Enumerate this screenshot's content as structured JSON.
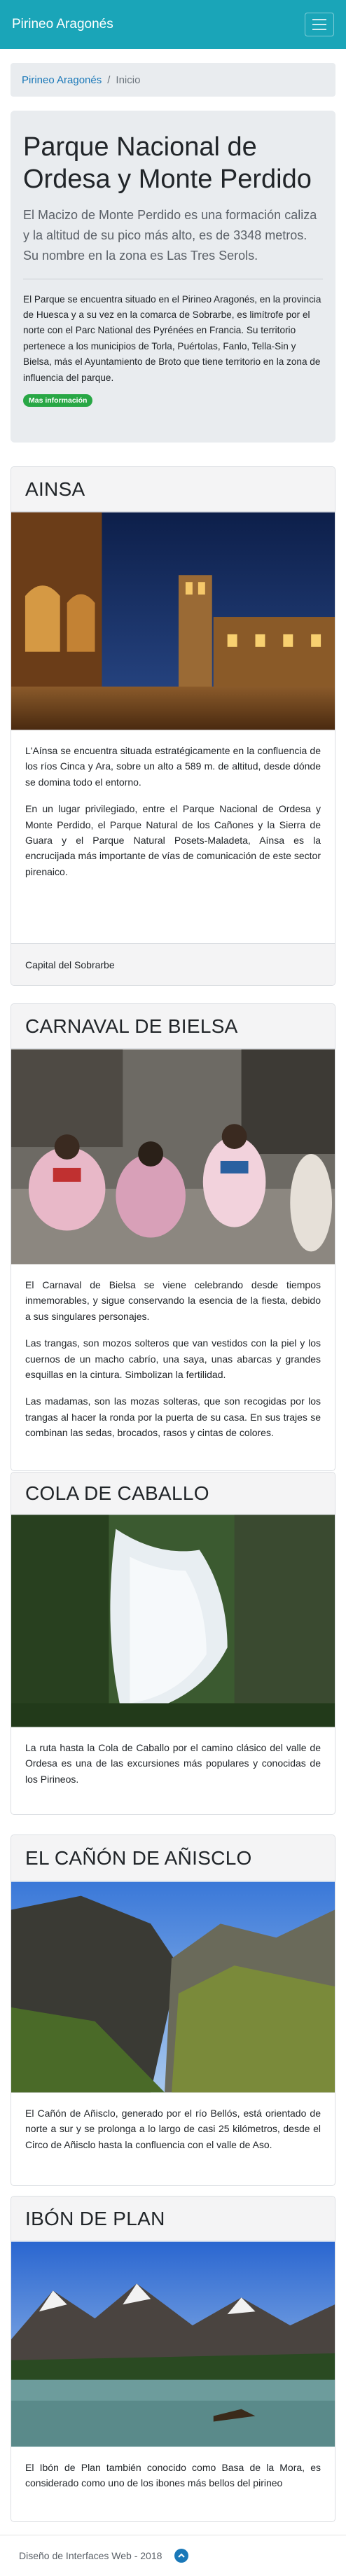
{
  "navbar": {
    "brand": "Pirineo Aragonés"
  },
  "breadcrumb": {
    "home": "Pirineo Aragonés",
    "separator": "/",
    "current": "Inicio"
  },
  "jumbotron": {
    "title": "Parque Nacional de Ordesa y Monte Perdido",
    "lead": "El Macizo de Monte Perdido es una formación caliza y la altitud de su pico más alto, es de 3348 metros. Su nombre en la zona es Las Tres Serols.",
    "body": "El Parque se encuentra situado en el Pirineo Aragonés, en la provincia de Huesca y a su vez en la comarca de Sobrarbe, es limítrofe por el norte con el Parc National des Pyrénées en Francia. Su territorio pertenece a los municipios de Torla, Puértolas, Fanlo, Tella-Sin y Bielsa, más el Ayuntamiento de Broto que tiene territorio en la zona de influencia del parque.",
    "badge": "Mas información"
  },
  "cards": [
    {
      "title": "AINSA",
      "paragraphs": [
        "L'Aínsa se encuentra situada estratégicamente en la confluencia de los ríos Cinca y Ara, sobre un alto a 589 m. de altitud, desde dónde se domina todo el entorno.",
        "En un lugar privilegiado, entre el Parque Nacional de Ordesa y Monte Perdido, el Parque Natural de los Cañones y la Sierra de Guara y el Parque Natural Posets-Maladeta, Aínsa es la encrucijada más importante de vías de comunicación de este sector pirenaico."
      ],
      "footer": "Capital del Sobrarbe"
    },
    {
      "title": "CARNAVAL DE BIELSA",
      "paragraphs": [
        "El Carnaval de Bielsa se viene celebrando desde tiempos inmemorables, y sigue conservando la esencia de la fiesta, debido a sus singulares personajes.",
        "Las trangas, son mozos solteros que van vestidos con la piel y los cuernos de un macho cabrío, una saya, unas abarcas y grandes esquillas en la cintura. Simbolizan la fertilidad.",
        "Las madamas, son las mozas solteras, que son recogidas por los trangas al hacer la ronda por la puerta de su casa. En sus trajes se combinan las sedas, brocados, rasos y cintas de colores."
      ]
    },
    {
      "title": "COLA DE CABALLO",
      "paragraphs": [
        "La ruta hasta la Cola de Caballo por el camino clásico del valle de Ordesa es una de las excursiones más populares y conocidas de los Pirineos."
      ]
    },
    {
      "title": "EL CAÑÓN DE AÑISCLO",
      "paragraphs": [
        "El Cañón de Añisclo, generado por el río Bellós, está orientado de norte a sur y se prolonga a lo largo de casi 25 kilómetros, desde el Circo de Añisclo hasta la confluencia con el valle de Aso."
      ]
    },
    {
      "title": "IBÓN DE PLAN",
      "paragraphs": [
        "El Ibón de Plan también conocido como Basa de la Mora, es considerado como uno de los ibones más bellos del pirineo"
      ]
    }
  ],
  "footer": {
    "text": "Diseño de Interfaces Web - 2018"
  },
  "colors": {
    "navbar": "#1aa5b8",
    "link": "#1a78b8",
    "badge": "#28a745"
  }
}
